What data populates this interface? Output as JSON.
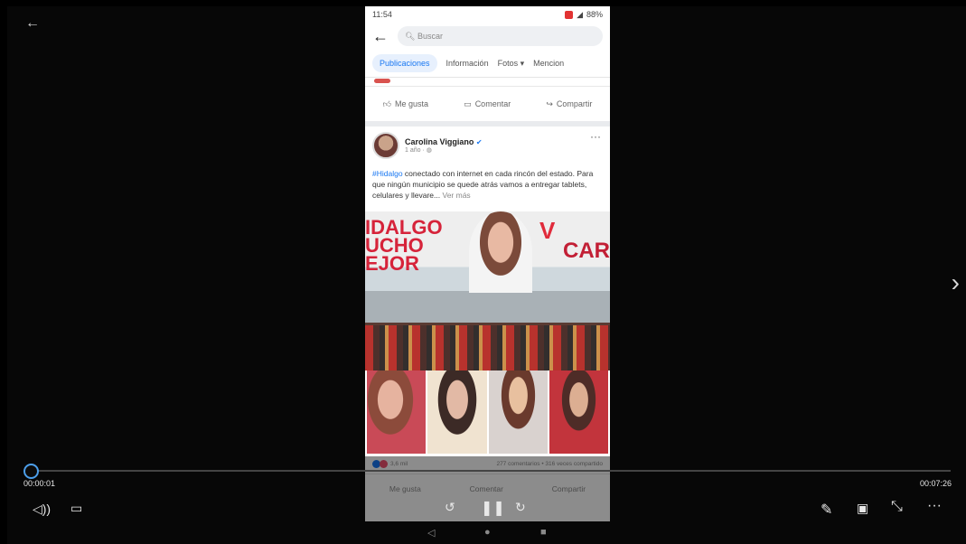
{
  "player": {
    "back_icon": "back-arrow-icon",
    "current_time": "00:00:01",
    "total_time": "00:07:26",
    "progress": 0.002,
    "accent": "#4c9eea",
    "next_icon": "chevron-right-icon"
  },
  "phone": {
    "status": {
      "time": "11:54",
      "battery": "88%"
    },
    "search": {
      "placeholder": "Buscar"
    },
    "tabs": [
      "Publicaciones",
      "Información",
      "Fotos ▾",
      "Mencion"
    ],
    "actions": {
      "like": "Me gusta",
      "comment": "Comentar",
      "share": "Compartir"
    },
    "post": {
      "author": "Carolina Viggiano",
      "time": "1 año",
      "hashtag": "#Hidalgo",
      "text": " conectado con internet en cada rincón del estado. Para que ningún municipio se quede atrás vamos a entregar tablets, celulares y llevare...",
      "see_more": "Ver más",
      "banner_left": "IDALGO\nUCHO\nEJOR",
      "banner_right": "CAR",
      "banner_v": "V",
      "reactions_count": "3,6 mil",
      "comments_shares": "277 comentarios • 316 veces compartido"
    }
  }
}
